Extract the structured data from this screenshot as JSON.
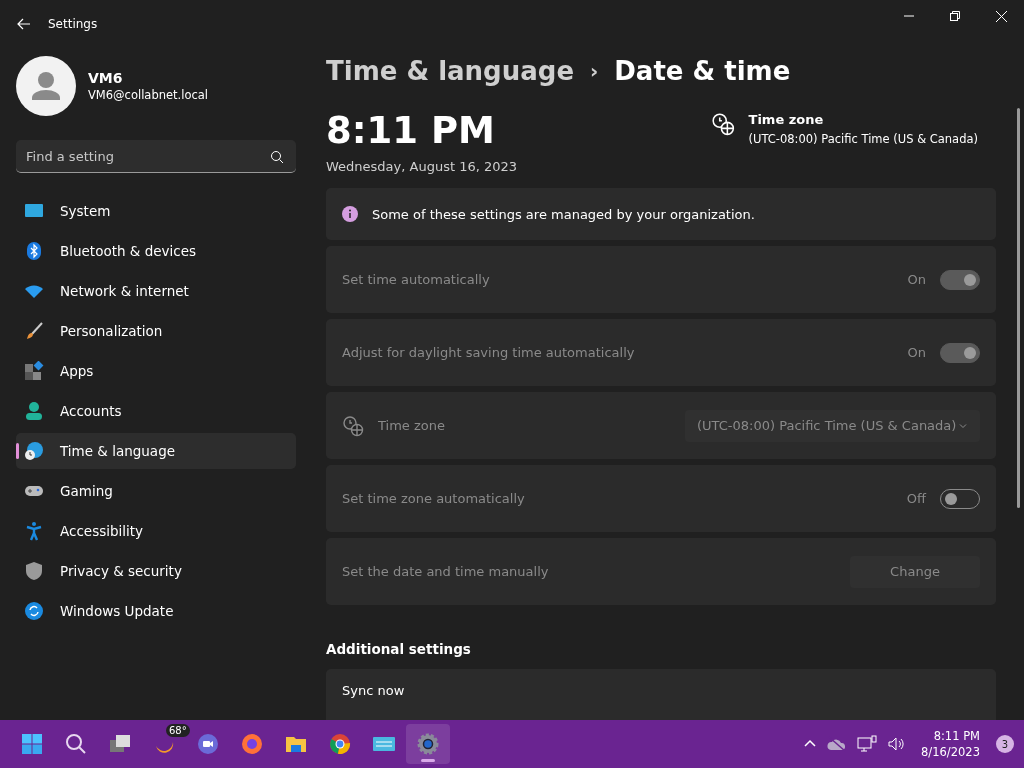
{
  "window": {
    "title": "Settings"
  },
  "user": {
    "name": "VM6",
    "email": "VM6@collabnet.local"
  },
  "search": {
    "placeholder": "Find a setting"
  },
  "sidebar": {
    "items": [
      {
        "label": "System",
        "selected": false
      },
      {
        "label": "Bluetooth & devices",
        "selected": false
      },
      {
        "label": "Network & internet",
        "selected": false
      },
      {
        "label": "Personalization",
        "selected": false
      },
      {
        "label": "Apps",
        "selected": false
      },
      {
        "label": "Accounts",
        "selected": false
      },
      {
        "label": "Time & language",
        "selected": true
      },
      {
        "label": "Gaming",
        "selected": false
      },
      {
        "label": "Accessibility",
        "selected": false
      },
      {
        "label": "Privacy & security",
        "selected": false
      },
      {
        "label": "Windows Update",
        "selected": false
      }
    ]
  },
  "breadcrumb": {
    "parent": "Time & language",
    "separator": "›",
    "current": "Date & time"
  },
  "clock": {
    "time": "8:11 PM",
    "date": "Wednesday, August 16, 2023"
  },
  "time_zone_summary": {
    "label": "Time zone",
    "value": "(UTC-08:00) Pacific Time (US & Canada)"
  },
  "notice": {
    "text": "Some of these settings are managed by your organization."
  },
  "settings": [
    {
      "kind": "toggle",
      "label": "Set time automatically",
      "state_label": "On",
      "on": true,
      "disabled": true
    },
    {
      "kind": "toggle",
      "label": "Adjust for daylight saving time automatically",
      "state_label": "On",
      "on": true,
      "disabled": true
    },
    {
      "kind": "dropdown",
      "label": "Time zone",
      "value": "(UTC-08:00) Pacific Time (US & Canada)",
      "disabled": true
    },
    {
      "kind": "toggle",
      "label": "Set time zone automatically",
      "state_label": "Off",
      "on": false,
      "disabled": true
    },
    {
      "kind": "button",
      "label": "Set the date and time manually",
      "button": "Change",
      "disabled": true
    }
  ],
  "additional": {
    "heading": "Additional settings",
    "items": [
      {
        "label": "Sync now"
      }
    ]
  },
  "taskbar": {
    "apps": [
      {
        "selected": false
      },
      {
        "selected": false
      },
      {
        "selected": false
      },
      {
        "badge": "68°",
        "selected": false
      },
      {
        "selected": false
      },
      {
        "selected": false
      },
      {
        "selected": false
      },
      {
        "selected": false
      },
      {
        "selected": false
      },
      {
        "selected": true
      }
    ],
    "time": "8:11 PM",
    "date": "8/16/2023",
    "notifications": "3"
  }
}
